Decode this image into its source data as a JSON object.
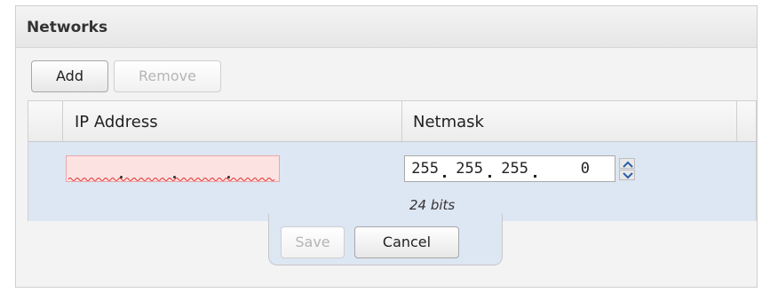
{
  "panel": {
    "title": "Networks"
  },
  "toolbar": {
    "add_label": "Add",
    "remove_label": "Remove"
  },
  "grid": {
    "columns": [
      "IP Address",
      "Netmask"
    ],
    "row": {
      "ip_address": "",
      "netmask_octets": [
        "255",
        "255",
        "255",
        "0"
      ],
      "netmask_hint": "24 bits"
    }
  },
  "editor": {
    "save_label": "Save",
    "cancel_label": "Cancel"
  },
  "colors": {
    "invalid_field": "#fde2e2",
    "row_highlight": "#dde6f3",
    "disabled_text": "#b5b5b5"
  }
}
